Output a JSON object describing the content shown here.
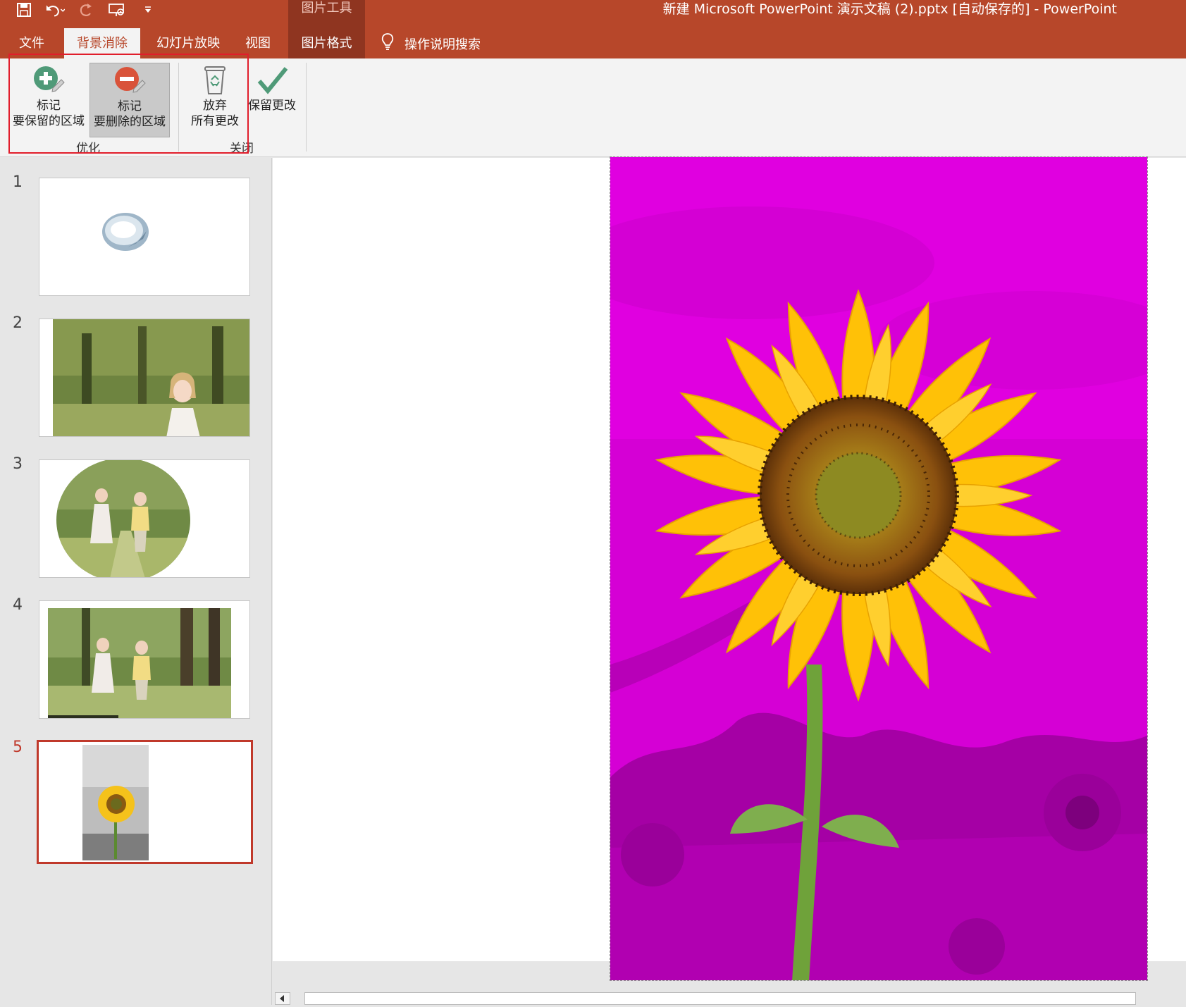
{
  "quick_access": {
    "save_icon": "save-icon",
    "undo_icon": "undo-icon",
    "redo_icon": "redo-icon",
    "present_icon": "present-from-start-icon",
    "customize_icon": "customize-qat-icon"
  },
  "contextual_tab_group": "图片工具",
  "document_title": "新建 Microsoft PowerPoint 演示文稿 (2).pptx [自动保存的]  -  PowerPoint",
  "tabs": [
    {
      "label": "文件"
    },
    {
      "label": "背景消除",
      "active": true
    },
    {
      "label": "幻灯片放映"
    },
    {
      "label": "视图"
    },
    {
      "label": "图片格式"
    }
  ],
  "tell_me": "操作说明搜索",
  "ribbon": {
    "mark_keep": {
      "line1": "标记",
      "line2": "要保留的区域"
    },
    "mark_remove": {
      "line1": "标记",
      "line2": "要删除的区域"
    },
    "discard": {
      "line1": "放弃",
      "line2": "所有更改"
    },
    "keep_changes": "保留更改",
    "group_refine": "优化",
    "group_close": "关闭"
  },
  "slides": [
    {
      "number": "1"
    },
    {
      "number": "2"
    },
    {
      "number": "3"
    },
    {
      "number": "4"
    },
    {
      "number": "5",
      "selected": true
    }
  ],
  "colors": {
    "brand": "#b7472a",
    "removal_overlay": "#e000e0",
    "highlight_box": "#e11d2b"
  }
}
